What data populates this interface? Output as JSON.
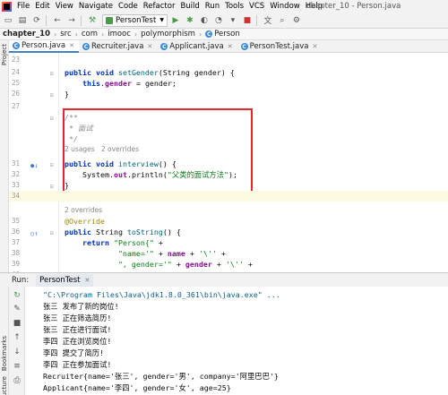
{
  "window": {
    "title": "chapter_10 - Person.java",
    "menu": [
      "File",
      "Edit",
      "View",
      "Navigate",
      "Code",
      "Refactor",
      "Build",
      "Run",
      "Tools",
      "VCS",
      "Window",
      "Help"
    ]
  },
  "toolbar": {
    "run_config": "PersonTest"
  },
  "breadcrumb": [
    "chapter_10",
    "src",
    "com",
    "imooc",
    "polymorphism",
    "Person"
  ],
  "side_labels": {
    "project": "Project",
    "bookmarks": "Bookmarks",
    "structure": "Structure"
  },
  "tabs": [
    {
      "label": "Person.java",
      "active": true
    },
    {
      "label": "Recruiter.java",
      "active": false
    },
    {
      "label": "Applicant.java",
      "active": false
    },
    {
      "label": "PersonTest.java",
      "active": false
    }
  ],
  "editor": {
    "lines": [
      {
        "n": "23",
        "parts": []
      },
      {
        "n": "24",
        "parts": [
          [
            "kw",
            "public void "
          ],
          [
            "fn",
            "setGender"
          ],
          [
            "plain",
            "(String gender) {"
          ]
        ]
      },
      {
        "n": "25",
        "parts": [
          [
            "plain",
            "    "
          ],
          [
            "kw",
            "this"
          ],
          [
            "plain",
            "."
          ],
          [
            "fld",
            "gender"
          ],
          [
            "plain",
            " = gender;"
          ]
        ]
      },
      {
        "n": "26",
        "parts": [
          [
            "plain",
            "}"
          ]
        ]
      },
      {
        "n": "27",
        "parts": []
      },
      {
        "n": "",
        "parts": [
          [
            "cmt",
            "/**"
          ]
        ]
      },
      {
        "n": "",
        "parts": [
          [
            "cmt",
            " * 面试"
          ]
        ]
      },
      {
        "n": "",
        "parts": [
          [
            "cmt",
            " */"
          ]
        ]
      },
      {
        "n": "",
        "hint": "2 usages   2 overrides"
      },
      {
        "n": "31",
        "parts": [
          [
            "kw",
            "public void "
          ],
          [
            "fn",
            "interview"
          ],
          [
            "plain",
            "() {"
          ]
        ]
      },
      {
        "n": "32",
        "parts": [
          [
            "plain",
            "    System."
          ],
          [
            "fld",
            "out"
          ],
          [
            "plain",
            ".println("
          ],
          [
            "str",
            "\"父类的面试方法\""
          ],
          [
            "plain",
            ");"
          ]
        ]
      },
      {
        "n": "33",
        "parts": [
          [
            "plain",
            "}"
          ]
        ]
      },
      {
        "n": "34",
        "parts": [],
        "current": true
      },
      {
        "n": "",
        "parts": []
      },
      {
        "n": "",
        "hint": "2 overrides"
      },
      {
        "n": "35",
        "parts": [
          [
            "ann",
            "@Override"
          ]
        ]
      },
      {
        "n": "36",
        "parts": [
          [
            "kw",
            "public "
          ],
          [
            "plain",
            "String "
          ],
          [
            "fn",
            "toString"
          ],
          [
            "plain",
            "() {"
          ]
        ]
      },
      {
        "n": "37",
        "parts": [
          [
            "plain",
            "    "
          ],
          [
            "kw",
            "return "
          ],
          [
            "str",
            "\"Person{\""
          ],
          [
            "plain",
            " +"
          ]
        ]
      },
      {
        "n": "38",
        "parts": [
          [
            "str",
            "            \"name='\""
          ],
          [
            "plain",
            " + "
          ],
          [
            "fld",
            "name"
          ],
          [
            "plain",
            " + "
          ],
          [
            "str",
            "'\\''"
          ],
          [
            "plain",
            " +"
          ]
        ]
      },
      {
        "n": "39",
        "parts": [
          [
            "str",
            "            \", gender='\""
          ],
          [
            "plain",
            " + "
          ],
          [
            "fld",
            "gender"
          ],
          [
            "plain",
            " + "
          ],
          [
            "str",
            "'\\''"
          ],
          [
            "plain",
            " +"
          ]
        ]
      },
      {
        "n": "40",
        "parts": [
          [
            "str",
            "            '}'"
          ],
          [
            "plain",
            ";"
          ]
        ]
      }
    ]
  },
  "run": {
    "label": "Run:",
    "tab": "PersonTest",
    "output": [
      "\"C:\\Program Files\\Java\\jdk1.8.0_361\\bin\\java.exe\" ...",
      "张三 发布了新的岗位!",
      "张三 正在筛选简历!",
      "张三 正在进行面试!",
      "李四 正在浏览岗位!",
      "李四 提交了简历!",
      "李四 正在参加面试!",
      "Recruiter{name='张三', gender='男', company='阿里巴巴'}",
      "Applicant{name='李四', gender='女', age=25}"
    ]
  },
  "colors": {
    "highlight_box": "#e8242d",
    "keyword": "#0033b3",
    "string": "#067d17",
    "field": "#871094"
  }
}
